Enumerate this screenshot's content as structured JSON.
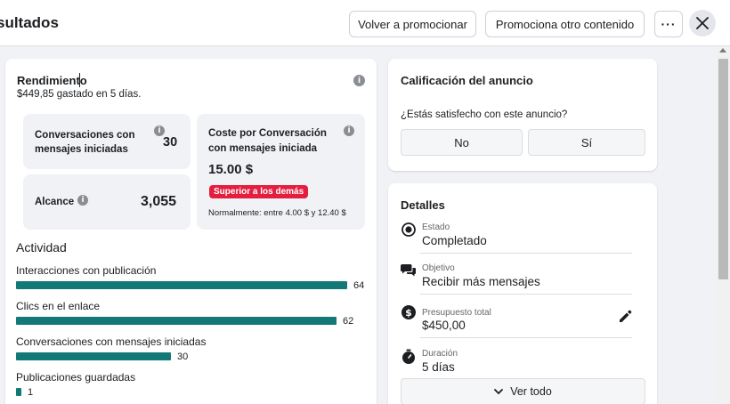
{
  "header": {
    "title": "sultados",
    "promote_again_label": "Volver a promocionar",
    "promote_other_label": "Promociona otro contenido",
    "more_label": "···"
  },
  "performance": {
    "title": "Rendimiento",
    "subtitle": "$449,85 gastado en 5 días.",
    "stats": {
      "conversations": {
        "label": "Conversaciones con mensajes iniciadas",
        "value": "30"
      },
      "reach": {
        "label": "Alcance",
        "value": "3,055"
      },
      "cost": {
        "label": "Coste por Conversación con mensajes iniciada",
        "value": "15.00 $",
        "badge": "Superior a los demás",
        "note": "Normalmente: entre 4.00 $ y 12.40 $"
      }
    }
  },
  "activity": {
    "title": "Actividad",
    "items": [
      {
        "label": "Interacciones con publicación",
        "value": 64
      },
      {
        "label": "Clics en el enlace",
        "value": 62
      },
      {
        "label": "Conversaciones con mensajes iniciadas",
        "value": 30
      },
      {
        "label": "Publicaciones guardadas",
        "value": 1
      }
    ]
  },
  "rating": {
    "title": "Calificación del anuncio",
    "question": "¿Estás satisfecho con este anuncio?",
    "no_label": "No",
    "yes_label": "Sí"
  },
  "details": {
    "title": "Detalles",
    "rows": [
      {
        "label": "Estado",
        "value": "Completado",
        "icon": "status-radio-icon"
      },
      {
        "label": "Objetivo",
        "value": "Recibir más mensajes",
        "icon": "chat-bubbles-icon"
      },
      {
        "label": "Presupuesto total",
        "value": "$450,00",
        "icon": "dollar-icon"
      },
      {
        "label": "Duración",
        "value": "5 días",
        "icon": "stopwatch-icon"
      }
    ],
    "see_all_label": "Ver todo"
  },
  "colors": {
    "bar": "#127977",
    "badge": "#e41e3f",
    "background": "#f0f2f5"
  }
}
